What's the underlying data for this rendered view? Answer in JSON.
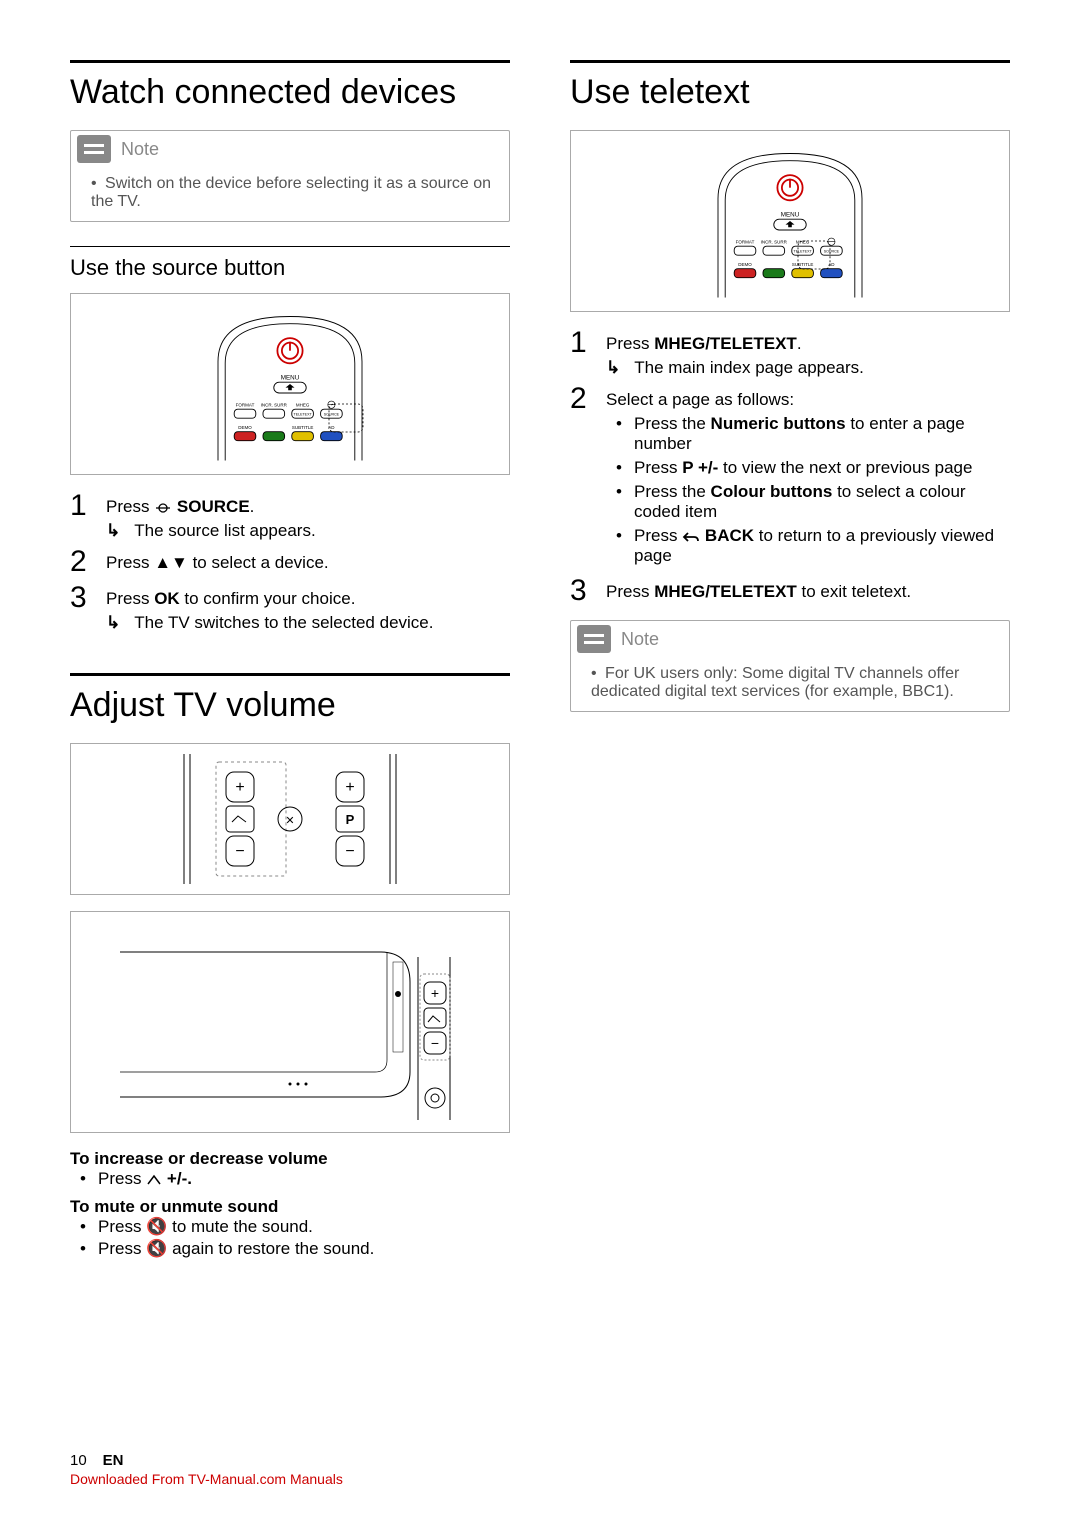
{
  "left": {
    "h1": "Watch connected devices",
    "note": {
      "title": "Note",
      "items": [
        "Switch on the device before selecting it as a source on the TV."
      ]
    },
    "h2_source": "Use the source button",
    "steps_source": {
      "s1_pre": "Press ",
      "s1_label": "SOURCE",
      "s1_post": ".",
      "s1_sub": "The source list appears.",
      "s2_pre": "Press ",
      "s2_post": " to select a device.",
      "s3_pre": "Press ",
      "s3_ok": "OK",
      "s3_post": " to confirm your choice.",
      "s3_sub": "The TV switches to the selected device."
    },
    "h1_vol": "Adjust TV volume",
    "vol": {
      "increase_head": "To increase or decrease volume",
      "increase_item_pre": "Press ",
      "increase_item_post": " +/-.",
      "mute_head": "To mute or unmute sound",
      "mute1_pre": "Press ",
      "mute1_post": " to mute the sound.",
      "mute2_pre": "Press ",
      "mute2_post": " again to restore the sound."
    }
  },
  "right": {
    "h1": "Use teletext",
    "steps": {
      "s1_pre": "Press ",
      "s1_label": "MHEG/TELETEXT",
      "s1_post": ".",
      "s1_sub": "The main index page appears.",
      "s2_pre": "Select a page as follows:",
      "s2_b1_pre": "Press the ",
      "s2_b1_bold": "Numeric buttons",
      "s2_b1_post": " to enter a page number",
      "s2_b2_pre": "Press ",
      "s2_b2_bold": "P +/-",
      "s2_b2_post": " to view the next or previous page",
      "s2_b3_pre": "Press the ",
      "s2_b3_bold": "Colour buttons",
      "s2_b3_post": " to select a colour coded item",
      "s2_b4_pre": "Press ",
      "s2_b4_bold": "BACK",
      "s2_b4_post": " to return to a previously viewed page",
      "s3_pre": "Press ",
      "s3_label": "MHEG/TELETEXT",
      "s3_post": " to exit teletext."
    },
    "note": {
      "title": "Note",
      "items": [
        "For UK users only: Some digital TV channels offer dedicated digital text services (for example, BBC1)."
      ]
    }
  },
  "remote_labels": {
    "menu": "MENU",
    "format": "FORMAT",
    "incr_surr": "INCR. SURR",
    "mheg": "MHEG",
    "teletext": "TELETEXT",
    "source": "SOURCE",
    "demo": "DEMO",
    "subtitle": "SUBTITLE",
    "ad": "AD"
  },
  "vol_buttons": {
    "plus": "+",
    "minus": "−",
    "p": "P"
  },
  "footer": {
    "page": "10",
    "lang": "EN",
    "download": "Downloaded From TV-Manual.com Manuals"
  }
}
